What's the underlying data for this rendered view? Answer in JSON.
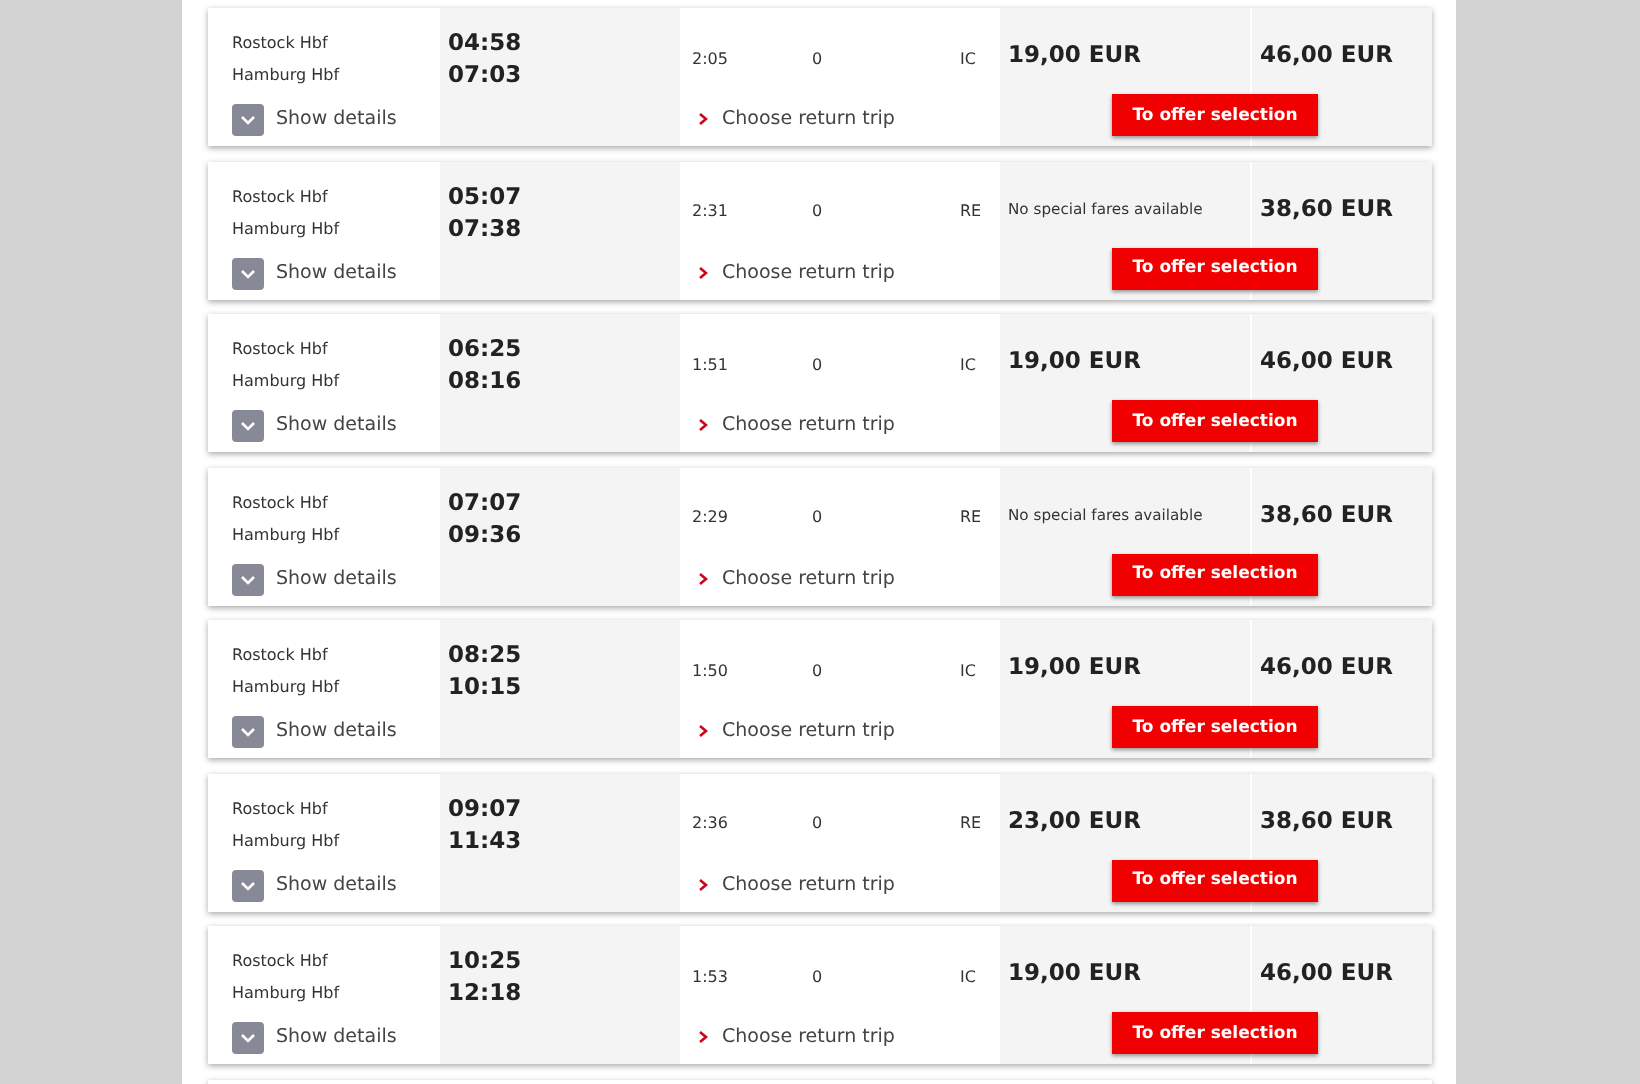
{
  "connections": [
    {
      "origin": "Rostock Hbf",
      "destination": "Hamburg Hbf",
      "departure": "04:58",
      "arrival": "07:03",
      "duration": "2:05",
      "changes": "0",
      "product": "IC",
      "saver_fare": {
        "kind": "price",
        "text": "19,00 EUR"
      },
      "flex_fare": "46,00 EUR",
      "details": "Show details",
      "return_link": "Choose return trip",
      "button": "To offer selection"
    },
    {
      "origin": "Rostock Hbf",
      "destination": "Hamburg Hbf",
      "departure": "05:07",
      "arrival": "07:38",
      "duration": "2:31",
      "changes": "0",
      "product": "RE",
      "saver_fare": {
        "kind": "note",
        "text": "No special fares available"
      },
      "flex_fare": "38,60 EUR",
      "details": "Show details",
      "return_link": "Choose return trip",
      "button": "To offer selection"
    },
    {
      "origin": "Rostock Hbf",
      "destination": "Hamburg Hbf",
      "departure": "06:25",
      "arrival": "08:16",
      "duration": "1:51",
      "changes": "0",
      "product": "IC",
      "saver_fare": {
        "kind": "price",
        "text": "19,00 EUR"
      },
      "flex_fare": "46,00 EUR",
      "details": "Show details",
      "return_link": "Choose return trip",
      "button": "To offer selection"
    },
    {
      "origin": "Rostock Hbf",
      "destination": "Hamburg Hbf",
      "departure": "07:07",
      "arrival": "09:36",
      "duration": "2:29",
      "changes": "0",
      "product": "RE",
      "saver_fare": {
        "kind": "note",
        "text": "No special fares available"
      },
      "flex_fare": "38,60 EUR",
      "details": "Show details",
      "return_link": "Choose return trip",
      "button": "To offer selection"
    },
    {
      "origin": "Rostock Hbf",
      "destination": "Hamburg Hbf",
      "departure": "08:25",
      "arrival": "10:15",
      "duration": "1:50",
      "changes": "0",
      "product": "IC",
      "saver_fare": {
        "kind": "price",
        "text": "19,00 EUR"
      },
      "flex_fare": "46,00 EUR",
      "details": "Show details",
      "return_link": "Choose return trip",
      "button": "To offer selection"
    },
    {
      "origin": "Rostock Hbf",
      "destination": "Hamburg Hbf",
      "departure": "09:07",
      "arrival": "11:43",
      "duration": "2:36",
      "changes": "0",
      "product": "RE",
      "saver_fare": {
        "kind": "price",
        "text": "23,00 EUR"
      },
      "flex_fare": "38,60 EUR",
      "details": "Show details",
      "return_link": "Choose return trip",
      "button": "To offer selection"
    },
    {
      "origin": "Rostock Hbf",
      "destination": "Hamburg Hbf",
      "departure": "10:25",
      "arrival": "12:18",
      "duration": "1:53",
      "changes": "0",
      "product": "IC",
      "saver_fare": {
        "kind": "price",
        "text": "19,00 EUR"
      },
      "flex_fare": "46,00 EUR",
      "details": "Show details",
      "return_link": "Choose return trip",
      "button": "To offer selection"
    }
  ]
}
